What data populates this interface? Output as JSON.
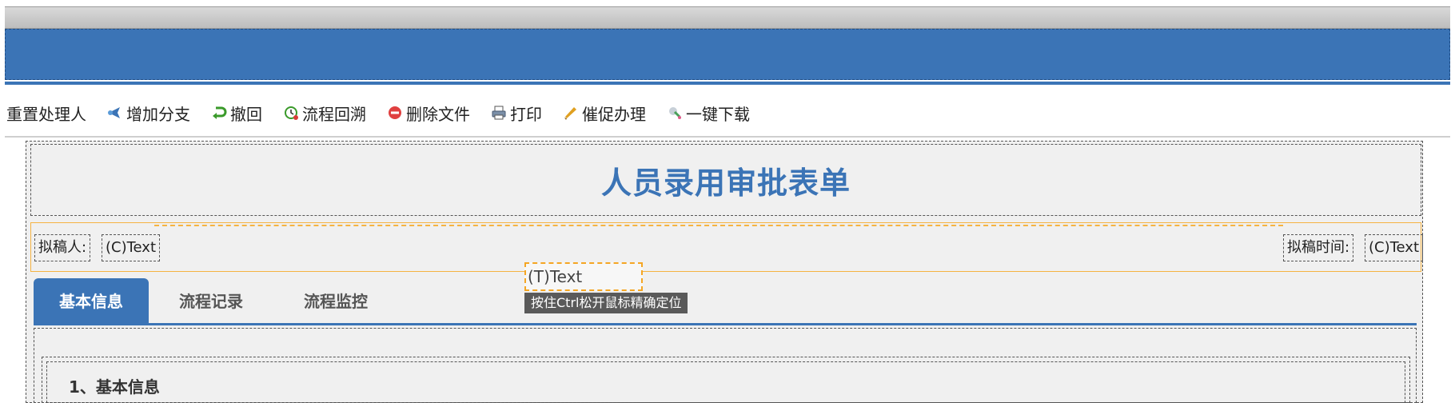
{
  "toolbar": {
    "items": [
      {
        "label": "重置处理人",
        "icon": ""
      },
      {
        "label": "增加分支",
        "icon": "branch-icon"
      },
      {
        "label": "撤回",
        "icon": "undo-arrow-icon"
      },
      {
        "label": "流程回溯",
        "icon": "clock-back-icon"
      },
      {
        "label": "删除文件",
        "icon": "delete-icon"
      },
      {
        "label": "打印",
        "icon": "printer-icon"
      },
      {
        "label": "催促办理",
        "icon": "megaphone-icon"
      },
      {
        "label": "一键下载",
        "icon": "download-icon"
      }
    ]
  },
  "form": {
    "title": "人员录用审批表单",
    "drafter_label": "拟稿人:",
    "drafter_value": "(C)Text",
    "draft_time_label": "拟稿时间:",
    "draft_time_value": "(C)Text"
  },
  "drag": {
    "proxy_text": "(T)Text",
    "tooltip": "按住Ctrl松开鼠标精确定位"
  },
  "tabs": [
    {
      "label": "基本信息",
      "active": true
    },
    {
      "label": "流程记录",
      "active": false
    },
    {
      "label": "流程监控",
      "active": false
    }
  ],
  "section": {
    "heading": "1、基本信息"
  },
  "colors": {
    "primary": "#3b74b6",
    "highlight": "#f5b342"
  }
}
